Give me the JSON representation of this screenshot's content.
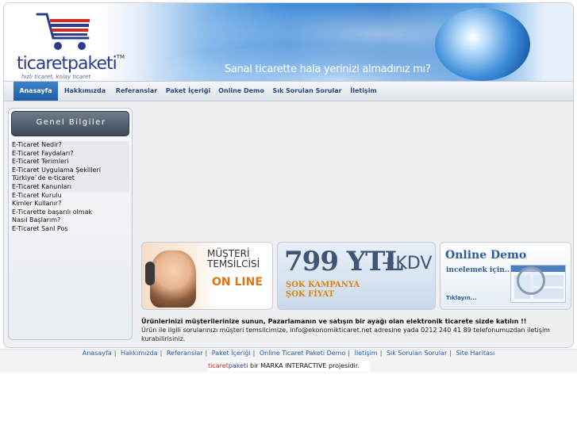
{
  "header": {
    "logo_text": "ticaretpaketi",
    "logo_tm": "TM",
    "logo_tagline": "hızlı ticaret, kolay ticaret",
    "slogan": "Sanal ticarette hala yerinizi almadınız mı?"
  },
  "nav": {
    "items": [
      {
        "label": "Anasayfa"
      },
      {
        "label": "Hakkımızda"
      },
      {
        "label": "Referanslar"
      },
      {
        "label": "Paket İçeriği"
      },
      {
        "label": "Online Demo"
      },
      {
        "label": "Sık Sorulan Sorular"
      },
      {
        "label": "İletişim"
      }
    ]
  },
  "sidebar": {
    "title": "Genel Bilgiler",
    "links": [
      "E-Ticaret Nedir?",
      "E-Ticaret Faydaları?",
      "E-Ticaret Terimleri",
      "E-Ticaret Uygulama Şekilleri",
      "Türkiye`de e-ticaret",
      "E-Ticaret Kanunları",
      "E-Ticaret Kurulu",
      "Kimler Kullanır?",
      "E-Ticarette başarılı olmak",
      "Nasıl Başlarım?",
      "E-Ticaret Sanl Pos"
    ]
  },
  "banners": {
    "rep_line1": "MÜŞTERİ",
    "rep_line2": "TEMSİLCİSİ",
    "rep_online": "ON LINE",
    "price": "799 YTL",
    "price_kdv": "+KDV",
    "price_line1": "ŞOK KAMPANYA",
    "price_line2": "ŞOK FİYAT",
    "demo_title": "Online Demo",
    "demo_sub": "incelemek için...",
    "demo_click": "Tıklayın..."
  },
  "content": {
    "headline": "Ürünlerinizi müşterilerinize sunun, Pazarlamanın ve satışın bir ayağı olan elektronik ticarete sizde katılın !!",
    "body": "Ürün ile ilgili sorularınızı müşteri temsilcimize, info@ekonomikticaret.net adresine yada 0212 240 41 89 telefonumuzdan iletişim kurabilirisiniz."
  },
  "footer": {
    "links": [
      "Anasayfa",
      "Hakkımızda",
      "Referanslar",
      "Paket İçeriği",
      "Online Ticaret Paketi Demo",
      "İletişim",
      "Sık Sorulan Sorular",
      "Site Haritası"
    ],
    "separator": "|",
    "credit_brand1": "ticaret",
    "credit_brand2": "paketi",
    "credit_rest": " bir MARKA INTERACTIVE projesidir."
  },
  "colors": {
    "nav_active": "#2f6fb3",
    "brand_blue": "#2b3d8a",
    "accent_orange": "#e0740e"
  }
}
